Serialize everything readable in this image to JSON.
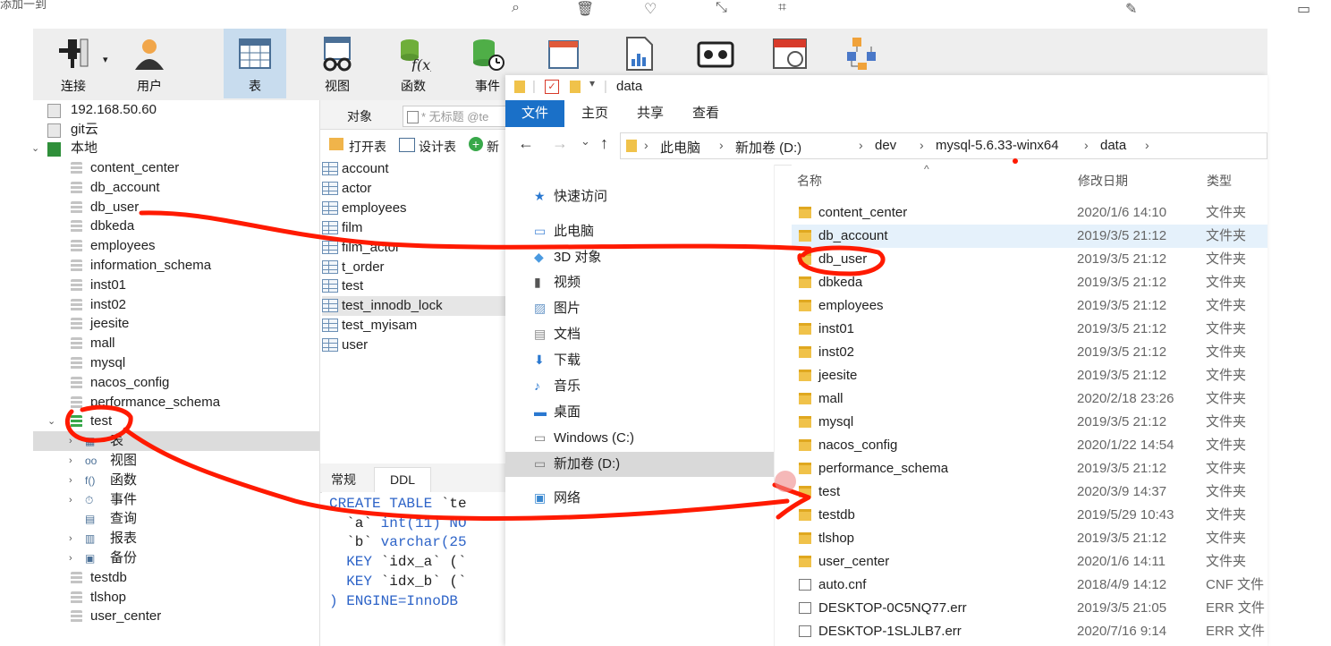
{
  "top_strip": {
    "left_text": "添加一到"
  },
  "toolbar": {
    "buttons": [
      {
        "label": "连接",
        "icon": "plug-icon"
      },
      {
        "label": "用户",
        "icon": "user-icon"
      },
      {
        "label": "表",
        "icon": "table-icon"
      },
      {
        "label": "视图",
        "icon": "view-icon"
      },
      {
        "label": "函数",
        "icon": "function-icon"
      },
      {
        "label": "事件",
        "icon": "event-icon"
      }
    ]
  },
  "tree": {
    "connections": [
      "192.168.50.60",
      "git云",
      "本地"
    ],
    "databases": [
      "content_center",
      "db_account",
      "db_user",
      "dbkeda",
      "employees",
      "information_schema",
      "inst01",
      "inst02",
      "jeesite",
      "mall",
      "mysql",
      "nacos_config",
      "performance_schema",
      "test"
    ],
    "test_children": [
      "表",
      "视图",
      "函数",
      "事件",
      "查询",
      "报表",
      "备份"
    ],
    "after": [
      "testdb",
      "tlshop",
      "user_center"
    ]
  },
  "middle": {
    "tab_object": "对象",
    "tab_untitled": "* 无标题 @te",
    "btn_open": "打开表",
    "btn_design": "设计表",
    "btn_new": "新",
    "tables": [
      "account",
      "actor",
      "employees",
      "film",
      "film_actor",
      "t_order",
      "test",
      "test_innodb_lock",
      "test_myisam",
      "user"
    ],
    "tab_general": "常规",
    "tab_ddl": "DDL"
  },
  "ddl": {
    "lines": [
      [
        "CREATE TABLE",
        " `te"
      ],
      [
        "  `a` ",
        "int(11) NO"
      ],
      [
        "  `b` ",
        "varchar(25"
      ],
      [
        "  KEY",
        " `idx_a` (`"
      ],
      [
        "  KEY",
        " `idx_b` (`"
      ],
      [
        ") ENGINE=InnoDB",
        " "
      ]
    ]
  },
  "explorer": {
    "title": "data",
    "ribbon": [
      "文件",
      "主页",
      "共享",
      "查看"
    ],
    "path": [
      "此电脑",
      "新加卷 (D:)",
      "dev",
      "mysql-5.6.33-winx64",
      "data"
    ],
    "nav": [
      {
        "label": "快速访问",
        "icon": "star-icon"
      },
      {
        "label": "此电脑",
        "icon": "computer-icon"
      },
      {
        "label": "3D 对象",
        "icon": "cube-icon"
      },
      {
        "label": "视频",
        "icon": "video-icon"
      },
      {
        "label": "图片",
        "icon": "picture-icon"
      },
      {
        "label": "文档",
        "icon": "document-icon"
      },
      {
        "label": "下载",
        "icon": "download-icon"
      },
      {
        "label": "音乐",
        "icon": "music-icon"
      },
      {
        "label": "桌面",
        "icon": "desktop-icon"
      },
      {
        "label": "Windows (C:)",
        "icon": "drive-icon"
      },
      {
        "label": "新加卷 (D:)",
        "icon": "drive-icon"
      },
      {
        "label": "网络",
        "icon": "network-icon"
      }
    ],
    "headers": {
      "name": "名称",
      "date": "修改日期",
      "type": "类型"
    },
    "files": [
      {
        "name": "content_center",
        "date": "2020/1/6 14:10",
        "type": "文件夹",
        "kind": "folder"
      },
      {
        "name": "db_account",
        "date": "2019/3/5 21:12",
        "type": "文件夹",
        "kind": "folder"
      },
      {
        "name": "db_user",
        "date": "2019/3/5 21:12",
        "type": "文件夹",
        "kind": "folder"
      },
      {
        "name": "dbkeda",
        "date": "2019/3/5 21:12",
        "type": "文件夹",
        "kind": "folder"
      },
      {
        "name": "employees",
        "date": "2019/3/5 21:12",
        "type": "文件夹",
        "kind": "folder"
      },
      {
        "name": "inst01",
        "date": "2019/3/5 21:12",
        "type": "文件夹",
        "kind": "folder"
      },
      {
        "name": "inst02",
        "date": "2019/3/5 21:12",
        "type": "文件夹",
        "kind": "folder"
      },
      {
        "name": "jeesite",
        "date": "2019/3/5 21:12",
        "type": "文件夹",
        "kind": "folder"
      },
      {
        "name": "mall",
        "date": "2020/2/18 23:26",
        "type": "文件夹",
        "kind": "folder"
      },
      {
        "name": "mysql",
        "date": "2019/3/5 21:12",
        "type": "文件夹",
        "kind": "folder"
      },
      {
        "name": "nacos_config",
        "date": "2020/1/22 14:54",
        "type": "文件夹",
        "kind": "folder"
      },
      {
        "name": "performance_schema",
        "date": "2019/3/5 21:12",
        "type": "文件夹",
        "kind": "folder"
      },
      {
        "name": "test",
        "date": "2020/3/9 14:37",
        "type": "文件夹",
        "kind": "folder"
      },
      {
        "name": "testdb",
        "date": "2019/5/29 10:43",
        "type": "文件夹",
        "kind": "folder"
      },
      {
        "name": "tlshop",
        "date": "2019/3/5 21:12",
        "type": "文件夹",
        "kind": "folder"
      },
      {
        "name": "user_center",
        "date": "2020/1/6 14:11",
        "type": "文件夹",
        "kind": "folder"
      },
      {
        "name": "auto.cnf",
        "date": "2018/4/9 14:12",
        "type": "CNF 文件",
        "kind": "file"
      },
      {
        "name": "DESKTOP-0C5NQ77.err",
        "date": "2019/3/5 21:05",
        "type": "ERR 文件",
        "kind": "file"
      },
      {
        "name": "DESKTOP-1SLJLB7.err",
        "date": "2020/7/16 9:14",
        "type": "ERR 文件",
        "kind": "file"
      }
    ]
  },
  "colors": {
    "annotation": "#ff1a00",
    "ribbon_file": "#1a70c8",
    "selection": "#c8dcee"
  }
}
